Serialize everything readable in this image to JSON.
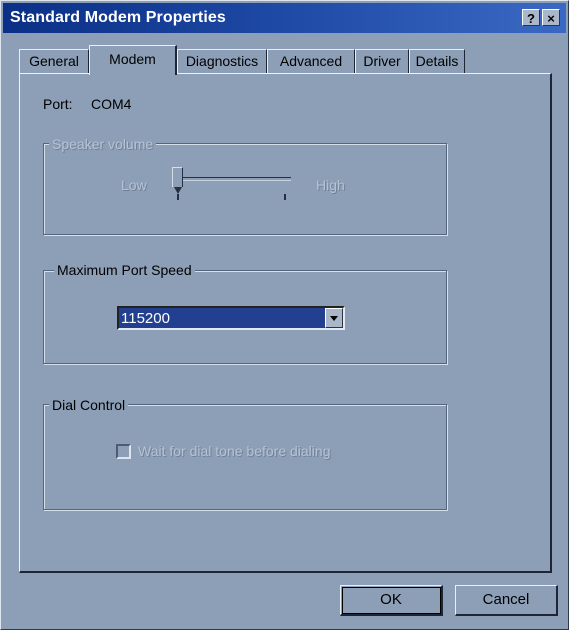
{
  "window": {
    "title": "Standard Modem Properties",
    "help_label": "?",
    "close_label": "×"
  },
  "tabs": [
    {
      "label": "General"
    },
    {
      "label": "Modem",
      "active": true
    },
    {
      "label": "Diagnostics"
    },
    {
      "label": "Advanced"
    },
    {
      "label": "Driver"
    },
    {
      "label": "Details"
    }
  ],
  "port": {
    "label": "Port:",
    "value": "COM4"
  },
  "speaker_volume": {
    "title": "Speaker volume",
    "low_label": "Low",
    "high_label": "High",
    "level": 0
  },
  "max_port_speed": {
    "title": "Maximum Port Speed",
    "selected": "115200"
  },
  "dial_control": {
    "title": "Dial Control",
    "checkbox_label": "Wait for dial tone before dialing",
    "checked": false
  },
  "buttons": {
    "ok": "OK",
    "cancel": "Cancel"
  },
  "colors": {
    "accent": "#0b2f86",
    "window_bg": "#8c9fb7",
    "selection": "#233f8f"
  }
}
